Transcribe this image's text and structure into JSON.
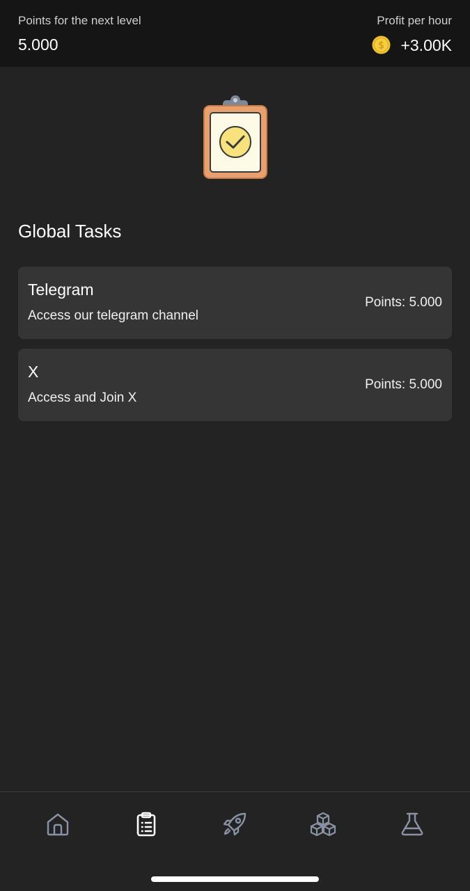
{
  "header": {
    "points_label": "Points for the next level",
    "points_value": "5.000",
    "profit_label": "Profit per hour",
    "profit_value": "+3.00K",
    "coin_icon": "dollar-coin-icon"
  },
  "hero": {
    "icon": "clipboard-check-icon"
  },
  "section": {
    "title": "Global Tasks"
  },
  "tasks": [
    {
      "title": "Telegram",
      "description": "Access our telegram channel",
      "points": "Points: 5.000"
    },
    {
      "title": "X",
      "description": "Access and Join X",
      "points": "Points: 5.000"
    }
  ],
  "nav": {
    "items": [
      {
        "icon": "home-icon",
        "active": false
      },
      {
        "icon": "clipboard-list-icon",
        "active": true
      },
      {
        "icon": "rocket-icon",
        "active": false
      },
      {
        "icon": "cubes-icon",
        "active": false
      },
      {
        "icon": "flask-icon",
        "active": false
      }
    ],
    "active_color": "#ffffff",
    "inactive_color": "#8a93a3"
  },
  "colors": {
    "background": "#232323",
    "header_bg": "#151515",
    "card_bg": "#353535",
    "coin": "#f2c22e"
  }
}
